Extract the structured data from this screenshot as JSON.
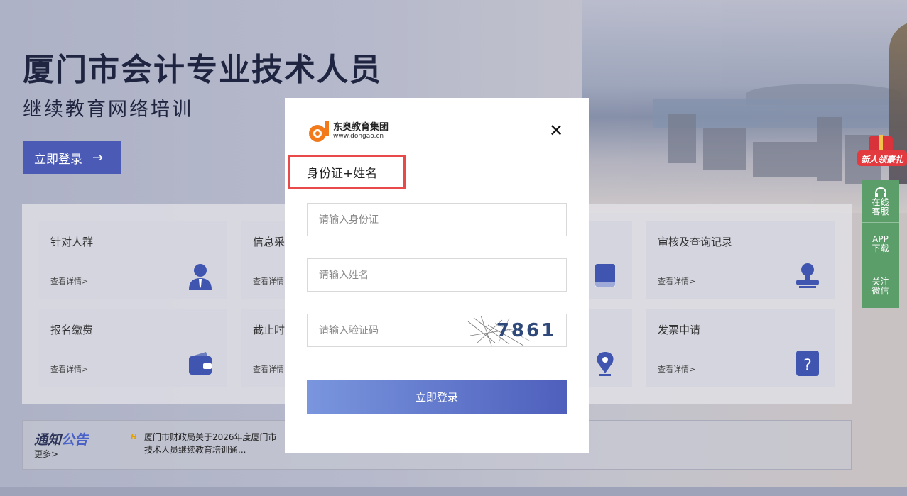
{
  "hero": {
    "title": "厦门市会计专业技术人员",
    "subtitle": "继续教育网络培训",
    "login_label": "立即登录",
    "login_arrow": "→"
  },
  "cards": [
    {
      "title": "针对人群",
      "more": "查看详情>",
      "icon": "user-tie-icon"
    },
    {
      "title": "信息采",
      "more": "查看详情>",
      "icon": ""
    },
    {
      "title": "",
      "more": "",
      "icon": "book-icon"
    },
    {
      "title": "审核及查询记录",
      "more": "查看详情>",
      "icon": "stamp-icon"
    },
    {
      "title": "报名缴费",
      "more": "查看详情>",
      "icon": "wallet-icon"
    },
    {
      "title": "截止时",
      "more": "查看详情>",
      "icon": ""
    },
    {
      "title": "",
      "more": "",
      "icon": "pen-nib-icon"
    },
    {
      "title": "发票申请",
      "more": "查看详情>",
      "icon": "question-icon"
    }
  ],
  "notice": {
    "logo_a": "通知",
    "logo_b": "公告",
    "more": "更多>",
    "hot": "H",
    "text": "厦门市财政局关于2026年度厦门市会计专业技术人员继续教育培训通..."
  },
  "notice_text_line1": "厦门市财政局关于2026年度厦门市",
  "notice_text_line2": "技术人员继续教育培训通...",
  "gift": {
    "label": "新人领豪礼"
  },
  "side": {
    "service": "在线客服",
    "app": "APP下载",
    "follow": "关注微信"
  },
  "side_lines": {
    "service_1": "在线",
    "service_2": "客服",
    "app_1": "APP",
    "app_2": "下载",
    "follow_1": "关注",
    "follow_2": "微信"
  },
  "modal": {
    "brand_cn": "东奥教育集团",
    "brand_en": "www.dongao.cn",
    "close": "✕",
    "tab": "身份证+姓名",
    "id_placeholder": "请输入身份证",
    "name_placeholder": "请输入姓名",
    "code_placeholder": "请输入验证码",
    "captcha": "7861",
    "submit": "立即登录"
  },
  "colors": {
    "primary": "#4a5ab5",
    "highlight": "#e84a4a",
    "side": "#5b9e6a",
    "brand_orange": "#f27a1a"
  }
}
